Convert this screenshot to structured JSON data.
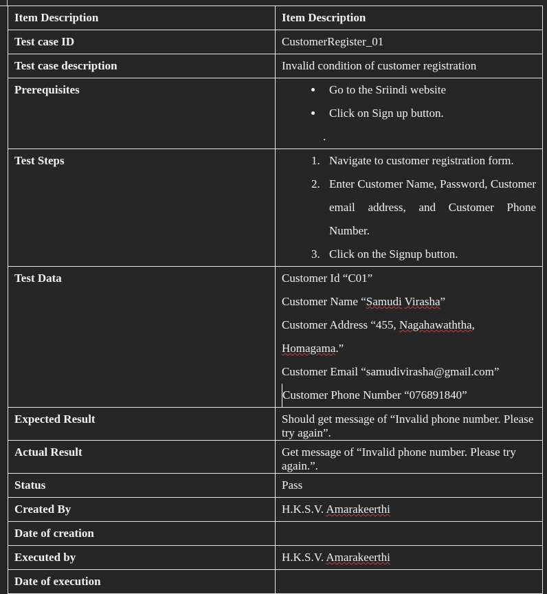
{
  "rows": [
    {
      "key": "Item Description",
      "value": "Item Description"
    },
    {
      "key": "Test case ID",
      "value": "CustomerRegister_01"
    },
    {
      "key": "Test case description",
      "value": "Invalid condition of customer registration"
    },
    {
      "key": "Prerequisites",
      "items": [
        "Go to the Sriindi website",
        "Click on Sign up button."
      ],
      "trailing": "."
    },
    {
      "key": "Test Steps",
      "items": [
        "Navigate to customer registration form.",
        "Enter Customer Name, Password, Customer email address, and Customer Phone Number.",
        "Click on the Signup button."
      ]
    },
    {
      "key": "Test Data",
      "lines": [
        "Customer Id “C01”",
        "Customer Name “Samudi Virasha”",
        "Customer Address “455, Nagahawaththa, Homagama.”",
        "Customer Email “samudivirasha@gmail.com”",
        "Customer Phone Number “076891840”"
      ]
    },
    {
      "key": "Expected Result",
      "value": "Should get message of “Invalid phone number. Please try again”."
    },
    {
      "key": "Actual Result",
      "value": "Get message of “Invalid phone number. Please try again.”."
    },
    {
      "key": "Status",
      "value": "Pass"
    },
    {
      "key": "Created By",
      "value": "H.K.S.V. Amarakeerthi"
    },
    {
      "key": "Date of creation",
      "value": ""
    },
    {
      "key": "Executed by",
      "value": "H.K.S.V. Amarakeerthi"
    },
    {
      "key": "Date of execution",
      "value": ""
    }
  ]
}
